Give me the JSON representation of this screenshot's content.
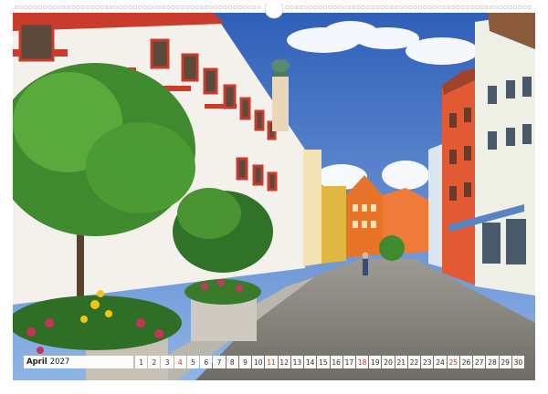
{
  "calendar": {
    "month": "April",
    "year": "2027",
    "days": [
      {
        "n": "1",
        "sun": false
      },
      {
        "n": "2",
        "sun": false
      },
      {
        "n": "3",
        "sun": false
      },
      {
        "n": "4",
        "sun": true
      },
      {
        "n": "5",
        "sun": false
      },
      {
        "n": "6",
        "sun": false
      },
      {
        "n": "7",
        "sun": false
      },
      {
        "n": "8",
        "sun": false
      },
      {
        "n": "9",
        "sun": false
      },
      {
        "n": "10",
        "sun": false
      },
      {
        "n": "11",
        "sun": true
      },
      {
        "n": "12",
        "sun": false
      },
      {
        "n": "13",
        "sun": false
      },
      {
        "n": "14",
        "sun": false
      },
      {
        "n": "15",
        "sun": false
      },
      {
        "n": "16",
        "sun": false
      },
      {
        "n": "17",
        "sun": false
      },
      {
        "n": "18",
        "sun": true
      },
      {
        "n": "19",
        "sun": false
      },
      {
        "n": "20",
        "sun": false
      },
      {
        "n": "21",
        "sun": false
      },
      {
        "n": "22",
        "sun": false
      },
      {
        "n": "23",
        "sun": false
      },
      {
        "n": "24",
        "sun": false
      },
      {
        "n": "25",
        "sun": true
      },
      {
        "n": "26",
        "sun": false
      },
      {
        "n": "27",
        "sun": false
      },
      {
        "n": "28",
        "sun": false
      },
      {
        "n": "29",
        "sun": false
      },
      {
        "n": "30",
        "sun": false
      }
    ]
  },
  "colors": {
    "sunday": "#c0392b",
    "sky": "#3f6fc4",
    "accent_orange": "#e8742a"
  }
}
